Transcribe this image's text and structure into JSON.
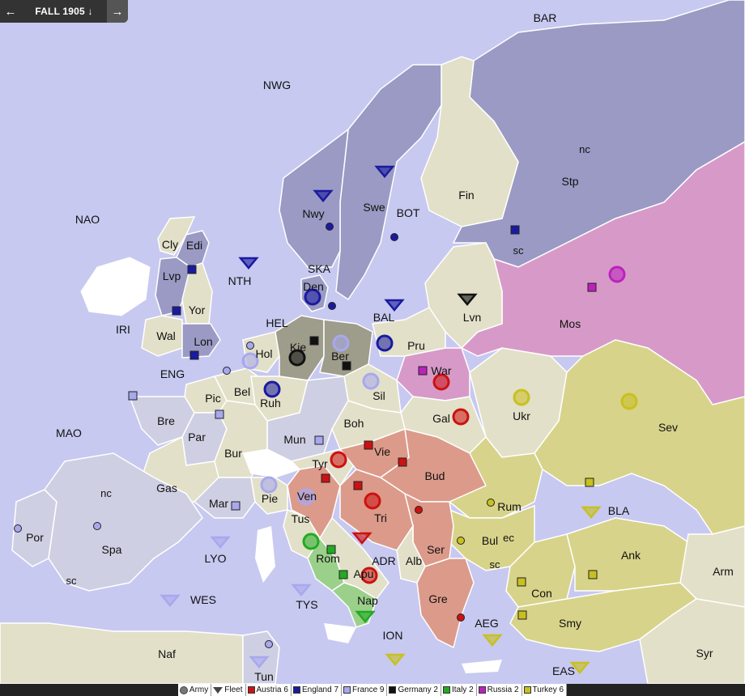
{
  "header": {
    "phase": "FALL 1905",
    "phase_arrow": "↓",
    "prev_icon": "←",
    "next_icon": "→"
  },
  "colors": {
    "sea": "#c7c9f0",
    "land": "#e2e0c8",
    "austria": "#cc1111",
    "england": "#1a1aa0",
    "france": "#a8a8ee",
    "germany": "#111111",
    "italy": "#22aa22",
    "russia": "#bb22bb",
    "turkey": "#c8c020",
    "neutral": "#999999"
  },
  "legend": [
    {
      "label": "Army",
      "kind": "army",
      "color": "#777777"
    },
    {
      "label": "Fleet",
      "kind": "fleet",
      "color": "#444444"
    },
    {
      "label": "Austria 6",
      "kind": "swatch",
      "color": "#cc1111"
    },
    {
      "label": "England 7",
      "kind": "swatch",
      "color": "#1a1aa0"
    },
    {
      "label": "France 9",
      "kind": "swatch",
      "color": "#a8a8ee"
    },
    {
      "label": "Germany 2",
      "kind": "swatch",
      "color": "#111111"
    },
    {
      "label": "Italy 2",
      "kind": "swatch",
      "color": "#22aa22"
    },
    {
      "label": "Russia 2",
      "kind": "swatch",
      "color": "#bb22bb"
    },
    {
      "label": "Turkey 6",
      "kind": "swatch",
      "color": "#c8c020"
    }
  ],
  "sea_labels": [
    "BAR",
    "NWG",
    "NAO",
    "NTH",
    "SKA",
    "HEL",
    "BAL",
    "BOT",
    "IRI",
    "ENG",
    "MAO",
    "LYO",
    "WES",
    "TYS",
    "ION",
    "ADR",
    "AEG",
    "EAS",
    "BLA"
  ],
  "land_labels": [
    "nc",
    "Stp",
    "sc",
    "Fin",
    "Swe",
    "Nwy",
    "Den",
    "Lvn",
    "Mos",
    "Cly",
    "Edi",
    "Lvp",
    "Yor",
    "Wal",
    "Lon",
    "Hol",
    "Kie",
    "Ber",
    "Pru",
    "War",
    "Bel",
    "Ruh",
    "Sil",
    "Pic",
    "Bre",
    "Par",
    "Bur",
    "Mun",
    "Boh",
    "Gal",
    "Ukr",
    "Sev",
    "Tyr",
    "Vie",
    "Bud",
    "Rum",
    "Gas",
    "Mar",
    "Pie",
    "Ven",
    "Tri",
    "Ser",
    "Bul",
    "ec",
    "sc",
    "Tus",
    "Rom",
    "Apu",
    "Alb",
    "Con",
    "Ank",
    "Arm",
    "nc",
    "Por",
    "Spa",
    "sc",
    "Nap",
    "Gre",
    "Smy",
    "Syr",
    "Naf",
    "Tun"
  ]
}
